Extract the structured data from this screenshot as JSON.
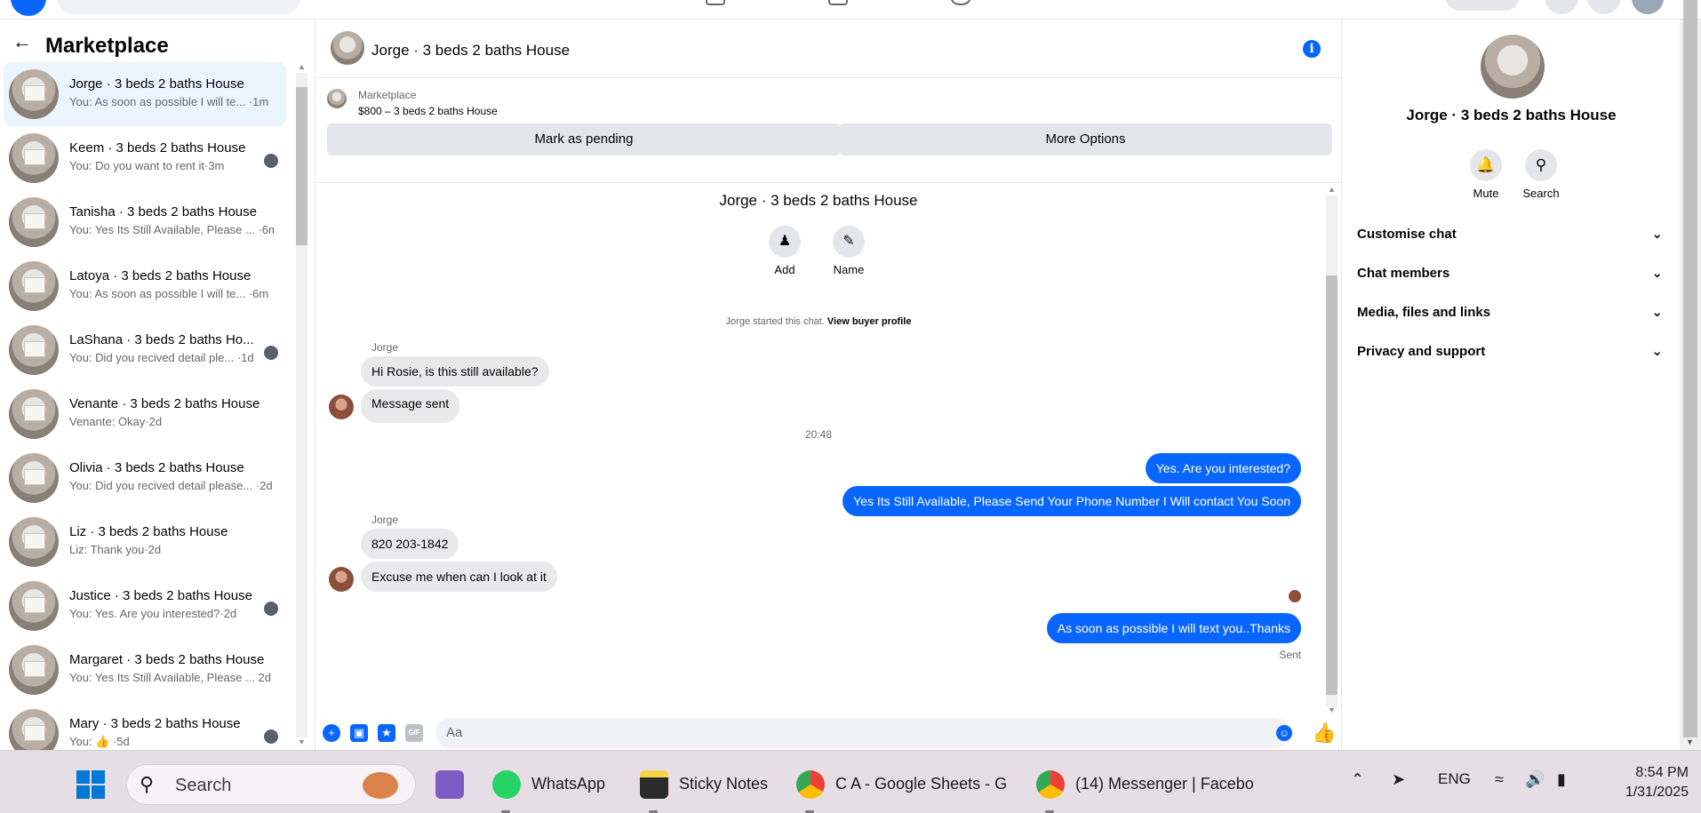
{
  "left_panel": {
    "title": "Marketplace",
    "conversations": [
      {
        "name": "Jorge · 3 beds 2 baths House",
        "preview": "You: As soon as possible I will te... ·1m",
        "active": true
      },
      {
        "name": "Keem · 3 beds 2 baths House",
        "preview": "You: Do you want to rent it·3m",
        "seen": true
      },
      {
        "name": "Tanisha · 3 beds 2 baths House",
        "preview": "You: Yes Its Still Available, Please ... ·6m"
      },
      {
        "name": "Latoya · 3 beds 2 baths House",
        "preview": "You: As soon as possible I will te... ·6m"
      },
      {
        "name": "LaShana · 3 beds 2 baths Ho...",
        "preview": "You: Did you recived detail ple... ·1d",
        "seen": true
      },
      {
        "name": "Venante · 3 beds 2 baths House",
        "preview": "Venante: Okay·2d"
      },
      {
        "name": "Olivia · 3 beds 2 baths House",
        "preview": "You: Did you recived detail please... ·2d"
      },
      {
        "name": "Liz · 3 beds 2 baths House",
        "preview": "Liz: Thank you·2d"
      },
      {
        "name": "Justice · 3 beds 2 baths House",
        "preview": "You: Yes. Are you interested?·2d",
        "seen": true
      },
      {
        "name": "Margaret · 3 beds 2 baths House",
        "preview": "You: Yes Its Still Available, Please ... 2d"
      },
      {
        "name": "Mary · 3 beds 2 baths House",
        "preview": "You: 👍 ·5d",
        "seen": true
      }
    ]
  },
  "chat": {
    "header_title": "Jorge · 3 beds 2 baths House",
    "listing_category": "Marketplace",
    "listing_price": "$800 – 3 beds 2 baths House",
    "mark_pending": "Mark as pending",
    "more_options": "More Options",
    "intro_title": "Jorge · 3 beds 2 baths House",
    "add_label": "Add",
    "name_label": "Name",
    "started_text": "Jorge started this chat.",
    "view_buyer": "View buyer profile",
    "sender_name": "Jorge",
    "msg1": "Hi Rosie, is this still available?",
    "msg2": "Message sent",
    "timestamp": "20:48",
    "out1": "Yes. Are you interested?",
    "out2": "Yes Its Still Available, Please Send Your Phone Number I Will contact You Soon",
    "sender_name2": "Jorge",
    "msg3": "820 203-1842",
    "msg4": "Excuse me when can I look at it",
    "out3": "As soon as possible I will text you..Thanks",
    "sent_status": "Sent",
    "input_placeholder": "Aa"
  },
  "right_panel": {
    "title": "Jorge · 3 beds 2 baths House",
    "mute_label": "Mute",
    "search_label": "Search",
    "sections": [
      "Customise chat",
      "Chat members",
      "Media, files and links",
      "Privacy and support"
    ]
  },
  "taskbar": {
    "search_label": "Search",
    "apps": [
      {
        "label": "WhatsApp"
      },
      {
        "label": "Sticky Notes"
      },
      {
        "label": "C A - Google Sheets - G"
      },
      {
        "label": "(14) Messenger | Facebo"
      }
    ],
    "language": "ENG",
    "time": "8:54 PM",
    "date": "1/31/2025"
  },
  "colors": {
    "accent": "#0866ff",
    "bubble_in": "#e9e9eb",
    "taskbar": "#e7dde4"
  },
  "icons": [
    "back-arrow-icon",
    "info-icon",
    "add-person-icon",
    "pencil-icon",
    "bell-icon",
    "search-icon",
    "chevron-down-icon",
    "plus-icon",
    "image-icon",
    "sticker-icon",
    "gif-icon",
    "emoji-icon",
    "thumbs-up-icon",
    "windows-icon",
    "wifi-icon",
    "volume-icon",
    "battery-icon"
  ]
}
